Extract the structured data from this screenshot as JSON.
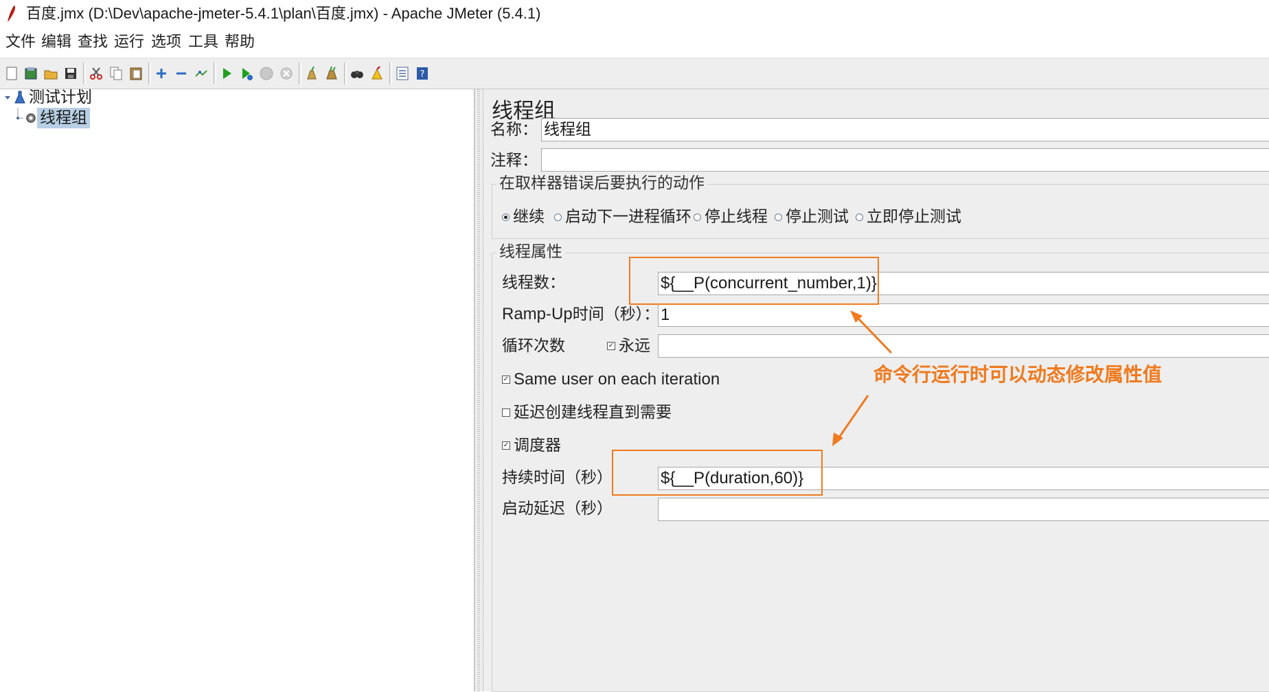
{
  "window": {
    "title": "百度.jmx (D:\\Dev\\apache-jmeter-5.4.1\\plan\\百度.jmx) - Apache JMeter (5.4.1)"
  },
  "menu": [
    "文件",
    "编辑",
    "查找",
    "运行",
    "选项",
    "工具",
    "帮助"
  ],
  "toolbar": {
    "icons": [
      "new-icon",
      "templates-icon",
      "open-icon",
      "save-icon",
      "cut-icon",
      "copy-icon",
      "paste-icon",
      "expand-icon",
      "collapse-icon",
      "toggle-icon",
      "start-icon",
      "start-no-pause-icon",
      "stop-icon",
      "shutdown-icon",
      "clear-icon",
      "clear-all-icon",
      "search-icon",
      "reset-search-icon",
      "function-helper-icon",
      "help-icon"
    ]
  },
  "tree": {
    "items": [
      {
        "label": "测试计划"
      },
      {
        "label": "线程组",
        "selected": true
      }
    ]
  },
  "panel": {
    "title": "线程组",
    "name_label": "名称：",
    "name_value": "线程组",
    "comment_label": "注释：",
    "comment_value": "",
    "error_group_title": "在取样器错误后要执行的动作",
    "error_options": [
      {
        "label": "继续",
        "selected": true
      },
      {
        "label": "启动下一进程循环",
        "selected": false
      },
      {
        "label": "停止线程",
        "selected": false
      },
      {
        "label": "停止测试",
        "selected": false
      },
      {
        "label": "立即停止测试",
        "selected": false
      }
    ],
    "thread_group_title": "线程属性",
    "threads_label": "线程数：",
    "threads_value": "${__P(concurrent_number,1)}",
    "rampup_label_en": "Ramp-Up",
    "rampup_label_cn": "时间（秒）：",
    "rampup_value": "1",
    "loop_label": "循环次数",
    "loop_forever_label": "永远",
    "loop_forever_checked": true,
    "loop_value": "",
    "same_user_label": "Same user on each iteration",
    "same_user_checked": true,
    "delay_create_label": "延迟创建线程直到需要",
    "delay_create_checked": false,
    "scheduler_label": "调度器",
    "scheduler_checked": true,
    "duration_label": "持续时间（秒）",
    "duration_value": "${__P(duration,60)}",
    "startup_delay_label": "启动延迟（秒）",
    "startup_delay_value": ""
  },
  "annotation": {
    "text": "命令行运行时可以动态修改属性值",
    "color": "#f07a1e"
  }
}
